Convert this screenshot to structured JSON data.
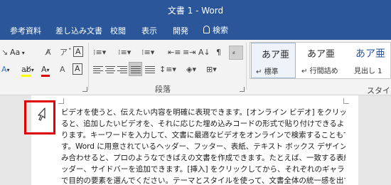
{
  "window": {
    "title": "文書 1  -  Word"
  },
  "tabs": [
    {
      "label": "参考資料"
    },
    {
      "label": "差し込み文書"
    },
    {
      "label": "校閲"
    },
    {
      "label": "表示"
    },
    {
      "label": "開発"
    }
  ],
  "tell_me": {
    "label": "検索"
  },
  "ribbon": {
    "font_group": {
      "font_size_label": "Aa",
      "clear_format_label": "A"
    },
    "paragraph_group": {
      "label": "段落"
    },
    "styles_group": {
      "label": "スタイル",
      "items": [
        {
          "sample": "あア亜",
          "name": "標準",
          "prefix": "↵"
        },
        {
          "sample": "あア亜",
          "name": "行間詰め",
          "prefix": "↵"
        },
        {
          "sample": "あア亜",
          "name": "見出し 1",
          "prefix": ""
        }
      ]
    }
  },
  "document": {
    "lines": [
      "ビデオを使うと、伝えたい内容を明確に表現できます。[オンライン ビデオ] をクリックす",
      "ると、追加したいビデオを、それに応じた埋め込みコードの形式で貼り付けできるようにな",
      "ります。キーワードを入力して、文書に最適なビデオをオンラインで検索することもできま",
      "す。Word に用意されているヘッダー、フッター、表紙、テキスト ボックス デザインを組",
      "み合わせると、プロのようなできばえの文書を作成できます。たとえば、一致する表紙、ヘ",
      "ッダー、サイドバーを追加できます。[挿入] をクリックしてから、それぞれのギャラリー",
      "で目的の要素を選んでください。テーマとスタイルを使って、文書全体の統一感を出すこと"
    ]
  },
  "colors": {
    "ribbon_blue": "#2b579a",
    "highlight_red": "#e00000"
  }
}
